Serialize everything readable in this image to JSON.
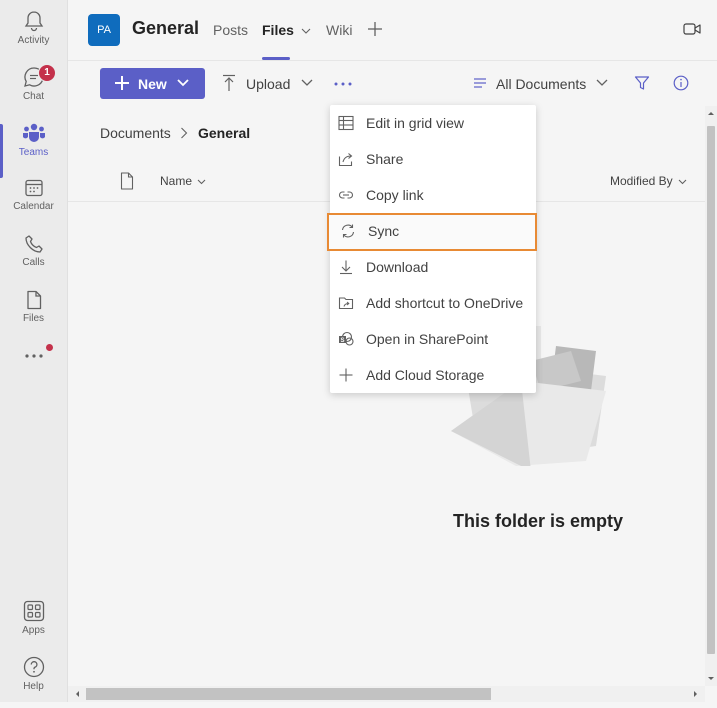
{
  "rail": {
    "items": [
      {
        "label": "Activity",
        "icon": "bell-icon"
      },
      {
        "label": "Chat",
        "icon": "chat-icon",
        "badge": "1"
      },
      {
        "label": "Teams",
        "icon": "teams-icon",
        "active": true
      },
      {
        "label": "Calendar",
        "icon": "calendar-icon"
      },
      {
        "label": "Calls",
        "icon": "phone-icon"
      },
      {
        "label": "Files",
        "icon": "file-icon"
      },
      {
        "label": "Apps",
        "icon": "apps-icon"
      },
      {
        "label": "Help",
        "icon": "help-icon"
      }
    ]
  },
  "header": {
    "avatar": "PA",
    "title": "General",
    "tabs": [
      {
        "label": "Posts"
      },
      {
        "label": "Files",
        "active": true
      },
      {
        "label": "Wiki"
      }
    ]
  },
  "toolbar": {
    "new_label": "New",
    "upload_label": "Upload",
    "view_label": "All Documents"
  },
  "content": {
    "breadcrumb": [
      "Documents",
      "General"
    ],
    "columns": {
      "name": "Name",
      "modified_by": "Modified By"
    },
    "empty_text": "This folder is empty"
  },
  "menu": {
    "items": [
      {
        "label": "Edit in grid view",
        "icon": "grid-icon"
      },
      {
        "label": "Share",
        "icon": "share-icon"
      },
      {
        "label": "Copy link",
        "icon": "link-icon"
      },
      {
        "label": "Sync",
        "icon": "sync-icon",
        "highlighted": true
      },
      {
        "label": "Download",
        "icon": "download-icon"
      },
      {
        "label": "Add shortcut to OneDrive",
        "icon": "shortcut-icon"
      },
      {
        "label": "Open in SharePoint",
        "icon": "sharepoint-icon"
      },
      {
        "label": "Add Cloud Storage",
        "icon": "plus-icon"
      }
    ]
  },
  "colors": {
    "accent": "#5b5fc7",
    "highlight": "#e88a34",
    "badge": "#c4314b",
    "avatar": "#0f6cbd"
  }
}
